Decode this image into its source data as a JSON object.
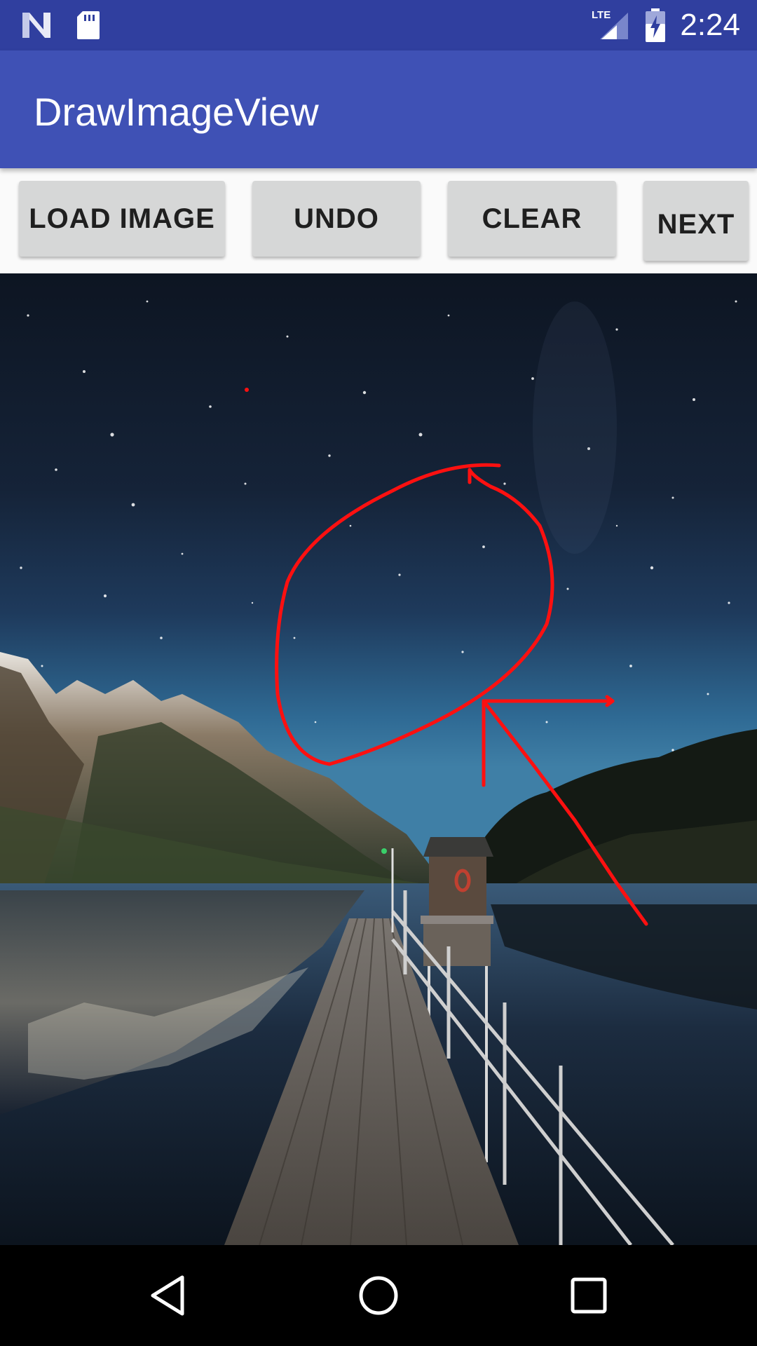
{
  "status_bar": {
    "time": "2:24",
    "network_label": "LTE",
    "icons": [
      "n-notification-icon",
      "sd-card-icon",
      "lte-signal-icon",
      "battery-charging-icon"
    ]
  },
  "app_bar": {
    "title": "DrawImageView"
  },
  "buttons": {
    "load_image": "LOAD IMAGE",
    "undo": "UNDO",
    "clear": "CLEAR",
    "next": "NEXT"
  },
  "canvas": {
    "content": "night lake pier photo",
    "stroke_color": "#ff1010"
  },
  "nav_bar": {
    "icons": [
      "back-icon",
      "home-icon",
      "recents-icon"
    ]
  },
  "colors": {
    "status_bar": "#303f9f",
    "app_bar": "#3f51b5",
    "button": "#d6d7d7"
  }
}
